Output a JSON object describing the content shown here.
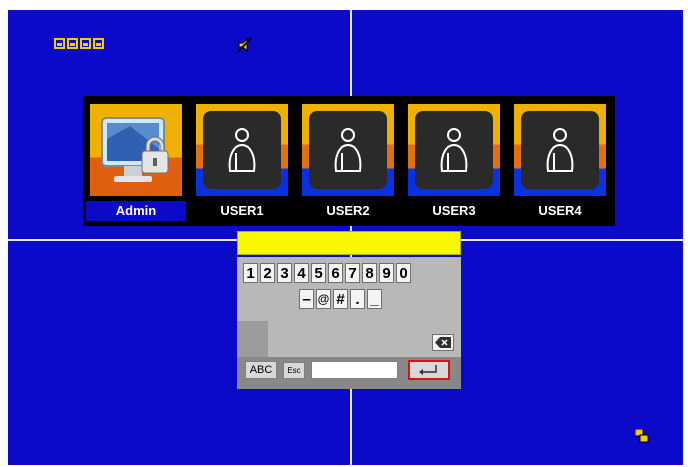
{
  "status": {
    "hdd_icons": [
      "hdd-icon",
      "hdd-icon",
      "hdd-icon",
      "hdd-icon"
    ],
    "mute_icon": "speaker-muted-icon",
    "network_icon": "network-icon"
  },
  "users": [
    {
      "label": "Admin",
      "icon": "admin-lock-monitor-icon",
      "selected": true
    },
    {
      "label": "USER1",
      "icon": "user-silhouette-icon",
      "selected": false
    },
    {
      "label": "USER2",
      "icon": "user-silhouette-icon",
      "selected": false
    },
    {
      "label": "USER3",
      "icon": "user-silhouette-icon",
      "selected": false
    },
    {
      "label": "USER4",
      "icon": "user-silhouette-icon",
      "selected": false
    }
  ],
  "keyboard": {
    "password_value": "",
    "digits": [
      "1",
      "2",
      "3",
      "4",
      "5",
      "6",
      "7",
      "8",
      "9",
      "0"
    ],
    "symbols": [
      "–",
      "@",
      "#",
      ".",
      "_"
    ],
    "abc_label": "ABC",
    "esc_label": "Esc",
    "text_value": "",
    "backspace_icon": "backspace-icon",
    "enter_icon": "enter-icon"
  },
  "colors": {
    "background": "#0a0ac8",
    "input_highlight": "#f8f800",
    "enter_border": "#e01010"
  }
}
